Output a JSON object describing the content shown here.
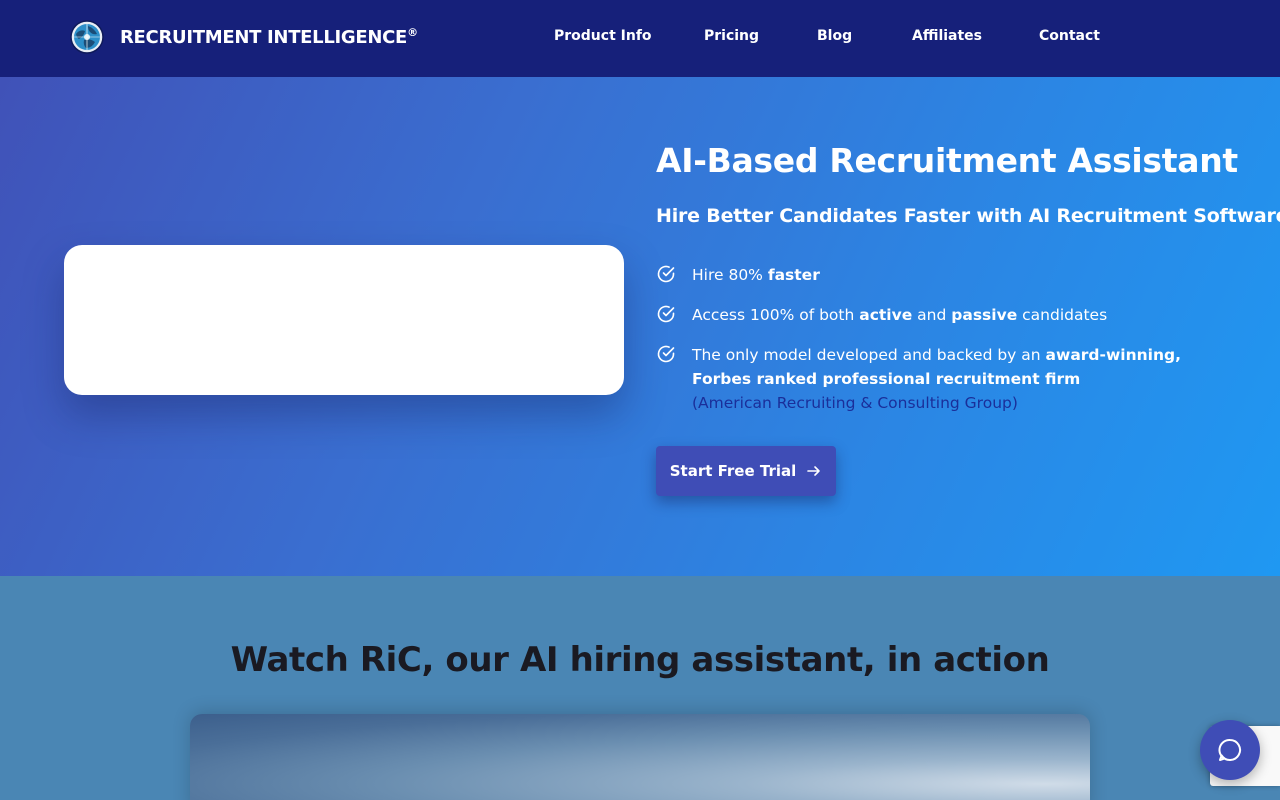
{
  "header": {
    "brand": "RECRUITMENT INTELLIGENCE",
    "brand_mark": "®",
    "nav": [
      "Product Info",
      "Pricing",
      "Blog",
      "Affiliates",
      "Contact"
    ]
  },
  "hero": {
    "title": "AI-Based Recruitment Assistant",
    "subtitle": "Hire Better Candidates Faster with AI Recruitment Software",
    "features": [
      {
        "parts": [
          "Hire 80% ",
          "faster"
        ]
      },
      {
        "parts": [
          "Access 100% of both ",
          "active",
          " and ",
          "passive",
          " candidates"
        ]
      },
      {
        "parts": [
          "The only model developed and backed by an ",
          "award-winning,",
          "Forbes ranked professional recruitment firm",
          "(American Recruiting & Consulting Group)"
        ]
      }
    ],
    "cta_label": "Start Free Trial"
  },
  "section": {
    "title": "Watch RiC, our AI hiring assistant, in action"
  },
  "icons": {
    "logo": "globe-logo-icon",
    "check": "check-circle-icon",
    "arrow": "arrow-right-icon",
    "chat": "chat-bubble-icon"
  },
  "colors": {
    "navbar": "#16207a",
    "cta": "#3f4db6",
    "link": "#1a2f9a",
    "section_bg": "#4a86b4"
  }
}
